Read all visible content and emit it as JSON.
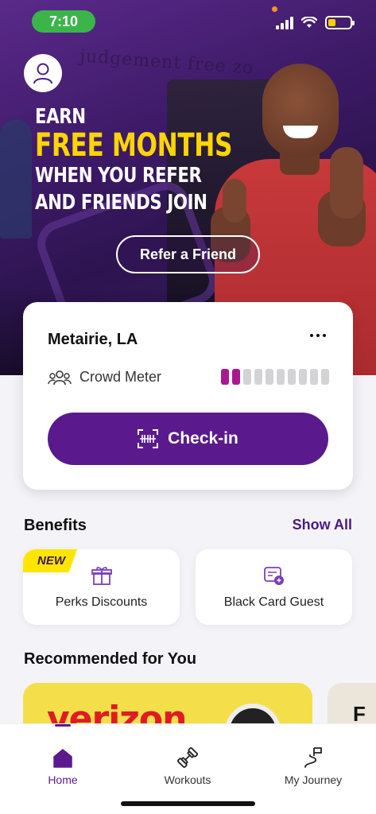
{
  "status_bar": {
    "time": "7:10"
  },
  "hero": {
    "background_sign": "judgement free zo",
    "promo_line1": "EARN",
    "promo_line2": "FREE MONTHS",
    "promo_line3": "WHEN YOU REFER",
    "promo_line4": "AND FRIENDS JOIN",
    "refer_button": "Refer a Friend"
  },
  "gym_card": {
    "location": "Metairie, LA",
    "crowd_label": "Crowd Meter",
    "crowd_level": 2,
    "crowd_max": 10,
    "checkin_button": "Check-in"
  },
  "benefits": {
    "title": "Benefits",
    "show_all": "Show All",
    "items": [
      {
        "label": "Perks Discounts",
        "badge": "NEW",
        "icon": "gift-icon"
      },
      {
        "label": "Black Card Guest",
        "icon": "guest-pass-icon"
      }
    ]
  },
  "recommended": {
    "title": "Recommended for You",
    "cards": [
      {
        "brand_text": "verizon"
      },
      {
        "brand_text": "F"
      }
    ]
  },
  "tab_bar": {
    "tabs": [
      {
        "label": "Home",
        "icon": "home-icon",
        "active": true
      },
      {
        "label": "Workouts",
        "icon": "dumbbell-icon",
        "active": false
      },
      {
        "label": "My Journey",
        "icon": "journey-icon",
        "active": false
      }
    ]
  },
  "colors": {
    "brand_purple": "#5a1a8e",
    "crowd_active": "#a8198f",
    "promo_yellow": "#ffd500",
    "new_badge": "#ffe500"
  }
}
